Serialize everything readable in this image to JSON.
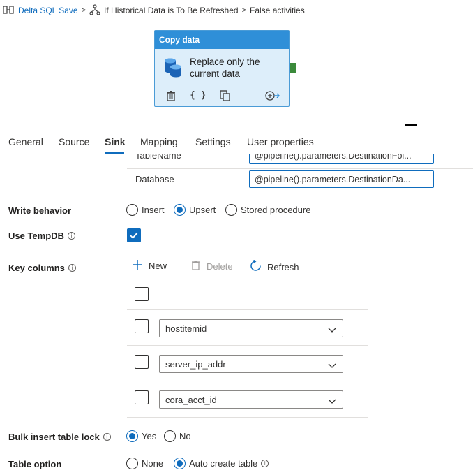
{
  "breadcrumb": {
    "pipeline": "Delta SQL Save",
    "condition": "If Historical Data is To Be Refreshed",
    "branch": "False activities",
    "separator": ">"
  },
  "activity": {
    "type": "Copy data",
    "name": "Replace only the current data"
  },
  "tabs": [
    "General",
    "Source",
    "Sink",
    "Mapping",
    "Settings",
    "User properties"
  ],
  "active_tab": "Sink",
  "table_params": {
    "table_label": "TableName",
    "table_value": "@pipeline().parameters.DestinationFol...",
    "db_label": "Database",
    "db_value": "@pipeline().parameters.DestinationDa..."
  },
  "write_behavior": {
    "label": "Write behavior",
    "options": [
      "Insert",
      "Upsert",
      "Stored procedure"
    ],
    "selected": "Upsert"
  },
  "use_tempdb": {
    "label": "Use TempDB",
    "checked": true
  },
  "key_columns": {
    "label": "Key columns",
    "toolbar": {
      "new": "New",
      "delete": "Delete",
      "refresh": "Refresh"
    },
    "rows": [
      "hostitemid",
      "server_ip_addr",
      "cora_acct_id"
    ]
  },
  "bulk_lock": {
    "label": "Bulk insert table lock",
    "options": [
      "Yes",
      "No"
    ],
    "selected": "Yes"
  },
  "table_option": {
    "label": "Table option",
    "options": [
      "None",
      "Auto create table"
    ],
    "selected": "Auto create table"
  },
  "colors": {
    "accent": "#0f6cbd",
    "card_header": "#2f8fd8",
    "card_body": "#ddeefa"
  }
}
